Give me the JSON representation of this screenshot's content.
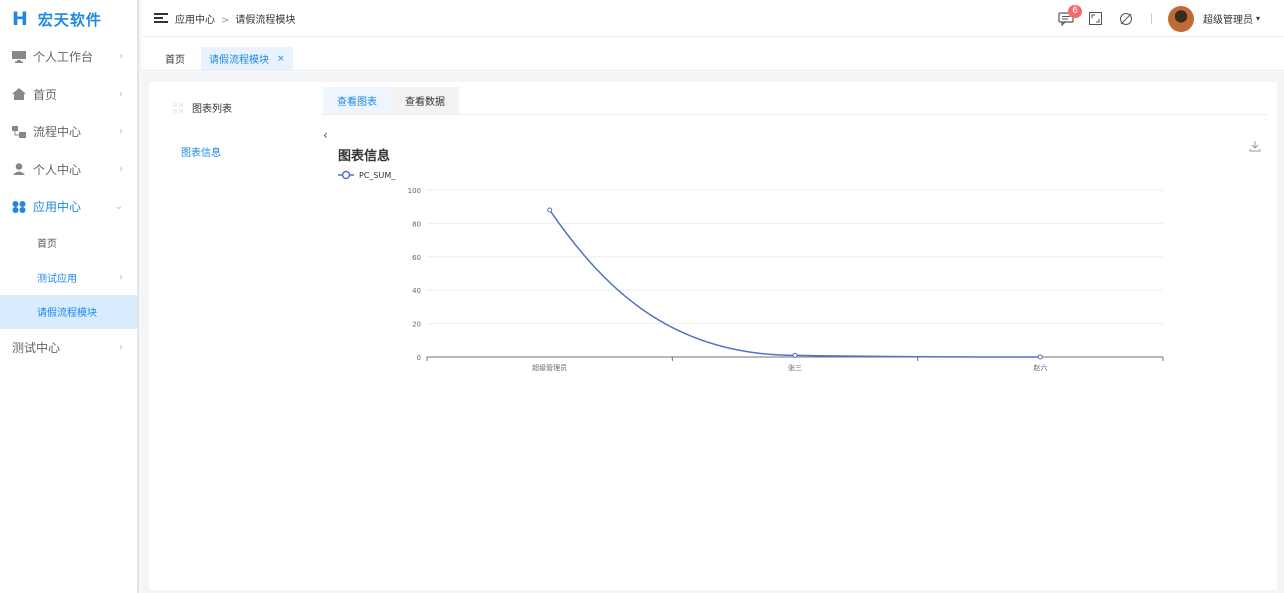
{
  "brand": {
    "logo_mark": "H",
    "name": "宏天软件",
    "accent": "#1e88e5"
  },
  "sidebar": {
    "items": [
      {
        "label": "个人工作台",
        "icon": "monitor-icon",
        "expanded": false
      },
      {
        "label": "首页",
        "icon": "home-icon",
        "expanded": false
      },
      {
        "label": "流程中心",
        "icon": "flow-icon",
        "expanded": false
      },
      {
        "label": "个人中心",
        "icon": "user-icon",
        "expanded": false
      },
      {
        "label": "应用中心",
        "icon": "apps-icon",
        "expanded": true,
        "children": [
          {
            "label": "首页"
          },
          {
            "label": "测试应用"
          },
          {
            "label": "请假流程模块",
            "selected": true
          }
        ]
      },
      {
        "label": "测试中心",
        "icon": "",
        "expanded": false
      }
    ]
  },
  "header": {
    "breadcrumb": [
      "应用中心",
      "请假流程模块"
    ],
    "separator": ">",
    "message_count": "6",
    "user_name": "超级管理员"
  },
  "tabs": [
    {
      "label": "首页",
      "active": false
    },
    {
      "label": "请假流程模块",
      "active": true,
      "close": "×"
    }
  ],
  "left_panel": {
    "title": "图表列表",
    "item": "图表信息"
  },
  "main": {
    "tabs": [
      {
        "label": "查看图表",
        "active": true
      },
      {
        "label": "查看数据",
        "active": false
      }
    ],
    "collapse": "‹"
  },
  "chart_data": {
    "type": "line",
    "title": "图表信息",
    "categories": [
      "超级管理员",
      "张三",
      "赵六"
    ],
    "series": [
      {
        "name": "PC_SUM_",
        "values": [
          88,
          1,
          0
        ],
        "color": "#5470c6",
        "smooth": true
      }
    ],
    "ylim": [
      0,
      100
    ],
    "yticks": [
      0,
      20,
      40,
      60,
      80,
      100
    ],
    "grid": true,
    "legend": "top-left"
  }
}
